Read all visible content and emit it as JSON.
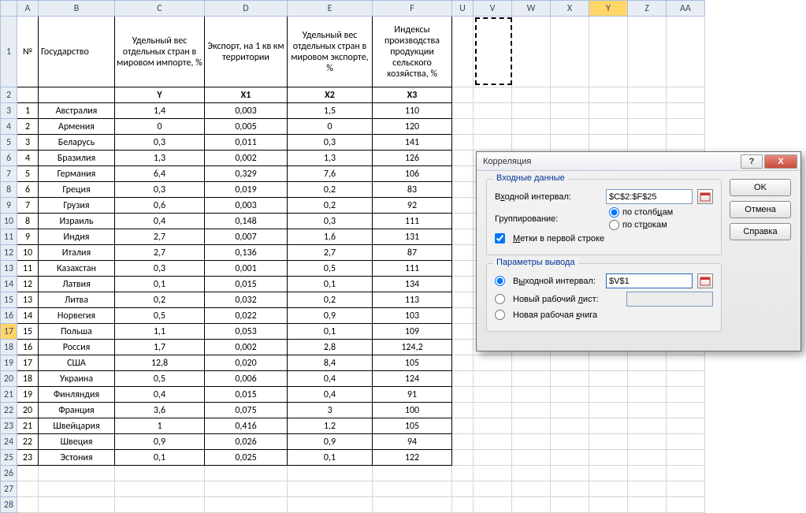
{
  "columns": [
    "",
    "A",
    "B",
    "C",
    "D",
    "E",
    "F",
    "U",
    "V",
    "W",
    "X",
    "Y",
    "Z",
    "AA"
  ],
  "header_row": 1,
  "varsRow": 2,
  "headers": {
    "num": "№",
    "state": "Государство",
    "c": "Удельный вес отдельных стран в мировом импорте, %",
    "d": "Экспорт, на 1 кв км территории",
    "e": "Удельный вес отдельных стран в мировом экспорте, %",
    "f": "Индексы производства продукции сельского хозяйства, %"
  },
  "vars": {
    "c": "Y",
    "d": "X1",
    "e": "X2",
    "f": "X3"
  },
  "rows": [
    {
      "n": "1",
      "state": "Австралия",
      "c": "1,4",
      "d": "0,003",
      "e": "1,5",
      "f": "110"
    },
    {
      "n": "2",
      "state": "Армения",
      "c": "0",
      "d": "0,005",
      "e": "0",
      "f": "120"
    },
    {
      "n": "3",
      "state": "Беларусь",
      "c": "0,3",
      "d": "0,011",
      "e": "0,3",
      "f": "141"
    },
    {
      "n": "4",
      "state": "Бразилия",
      "c": "1,3",
      "d": "0,002",
      "e": "1,3",
      "f": "126"
    },
    {
      "n": "5",
      "state": "Германия",
      "c": "6,4",
      "d": "0,329",
      "e": "7,6",
      "f": "106"
    },
    {
      "n": "6",
      "state": "Греция",
      "c": "0,3",
      "d": "0,019",
      "e": "0,2",
      "f": "83"
    },
    {
      "n": "7",
      "state": "Грузия",
      "c": "0,6",
      "d": "0,003",
      "e": "0,2",
      "f": "92"
    },
    {
      "n": "8",
      "state": "Израиль",
      "c": "0,4",
      "d": "0,148",
      "e": "0,3",
      "f": "111"
    },
    {
      "n": "9",
      "state": "Индия",
      "c": "2,7",
      "d": "0,007",
      "e": "1,6",
      "f": "131"
    },
    {
      "n": "10",
      "state": "Италия",
      "c": "2,7",
      "d": "0,136",
      "e": "2,7",
      "f": "87"
    },
    {
      "n": "11",
      "state": "Казахстан",
      "c": "0,3",
      "d": "0,001",
      "e": "0,5",
      "f": "111"
    },
    {
      "n": "12",
      "state": "Латвия",
      "c": "0,1",
      "d": "0,015",
      "e": "0,1",
      "f": "134"
    },
    {
      "n": "13",
      "state": "Литва",
      "c": "0,2",
      "d": "0,032",
      "e": "0,2",
      "f": "113"
    },
    {
      "n": "14",
      "state": "Норвегия",
      "c": "0,5",
      "d": "0,022",
      "e": "0,9",
      "f": "103"
    },
    {
      "n": "15",
      "state": "Польша",
      "c": "1,1",
      "d": "0,053",
      "e": "0,1",
      "f": "109"
    },
    {
      "n": "16",
      "state": "Россия",
      "c": "1,7",
      "d": "0,002",
      "e": "2,8",
      "f": "124,2"
    },
    {
      "n": "17",
      "state": "США",
      "c": "12,8",
      "d": "0,020",
      "e": "8,4",
      "f": "105"
    },
    {
      "n": "18",
      "state": "Украина",
      "c": "0,5",
      "d": "0,006",
      "e": "0,4",
      "f": "124"
    },
    {
      "n": "19",
      "state": "Финляндия",
      "c": "0,4",
      "d": "0,015",
      "e": "0,4",
      "f": "91"
    },
    {
      "n": "20",
      "state": "Франция",
      "c": "3,6",
      "d": "0,075",
      "e": "3",
      "f": "100"
    },
    {
      "n": "21",
      "state": "Швейцария",
      "c": "1",
      "d": "0,416",
      "e": "1,2",
      "f": "105"
    },
    {
      "n": "22",
      "state": "Швеция",
      "c": "0,9",
      "d": "0,026",
      "e": "0,9",
      "f": "94"
    },
    {
      "n": "23",
      "state": "Эстония",
      "c": "0,1",
      "d": "0,025",
      "e": "0,1",
      "f": "122"
    }
  ],
  "blank_rows_start": 26,
  "blank_rows_end": 28,
  "selected_row_header": "17",
  "selected_col_header": "Y",
  "dialog": {
    "title": "Корреляция",
    "help": "?",
    "close": "X",
    "input_group": "Входные данные",
    "input_range_label": "Входной интервал:",
    "input_range_value": "$C$2:$F$25",
    "grouping_label": "Группирование:",
    "by_cols": "по столбцам",
    "by_rows": "по строкам",
    "labels_first_row": "Метки в первой строке",
    "output_group": "Параметры вывода",
    "output_range_label": "Выходной интервал:",
    "output_range_value": "$V$1",
    "new_sheet": "Новый рабочий лист:",
    "new_book": "Новая рабочая книга",
    "ok": "OK",
    "cancel": "Отмена",
    "help_btn": "Справка"
  }
}
